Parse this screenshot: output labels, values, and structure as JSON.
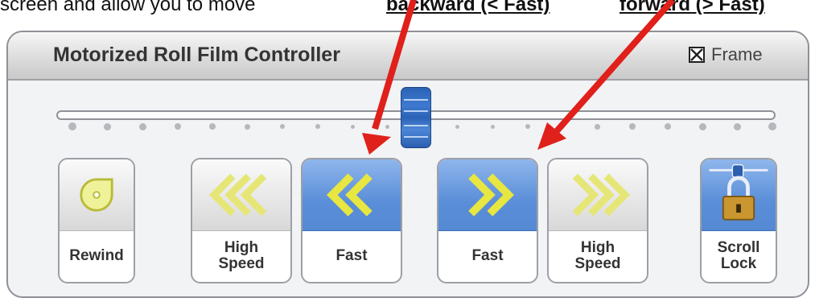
{
  "top_text": {
    "line_start": "screen and allow you to move",
    "backward_label": "backward (< Fast)",
    "forward_label": "forward (> Fast)"
  },
  "window": {
    "title": "Motorized Roll Film Controller",
    "frame_label": "Frame",
    "frame_checked": true
  },
  "slider": {
    "position_fraction": 0.5,
    "tick_count": 21
  },
  "buttons": [
    {
      "name": "rewind",
      "label_lines": [
        "Rewind"
      ],
      "icon": "rewind-icon",
      "active": false
    },
    {
      "name": "high-speed-backward",
      "label_lines": [
        "High",
        "Speed"
      ],
      "icon": "triple-chevron-left-icon",
      "active": false
    },
    {
      "name": "fast-backward",
      "label_lines": [
        "Fast"
      ],
      "icon": "double-chevron-left-icon",
      "active": true
    },
    {
      "name": "fast-forward",
      "label_lines": [
        "Fast"
      ],
      "icon": "double-chevron-right-icon",
      "active": true
    },
    {
      "name": "high-speed-forward",
      "label_lines": [
        "High",
        "Speed"
      ],
      "icon": "triple-chevron-right-icon",
      "active": false
    },
    {
      "name": "scroll-lock",
      "label_lines": [
        "Scroll",
        "Lock"
      ],
      "icon": "padlock-icon",
      "active": true
    }
  ],
  "colors": {
    "accent_blue": "#5a8ed8",
    "chevron_yellow": "#e8e640",
    "annotation_red": "#e0201b"
  }
}
